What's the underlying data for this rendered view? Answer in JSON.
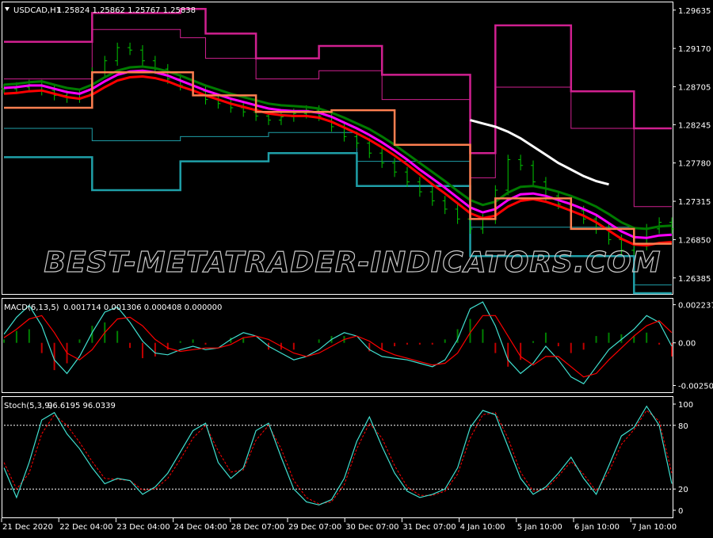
{
  "window": {
    "title": "USDCAD,H1",
    "ohlc": "1.25824 1.25862 1.25767 1.25838",
    "menu_icon": "triangle-down-icon"
  },
  "watermark": "BEST-METATRADER-INDICATORS.COM",
  "theme": {
    "background": "#000000",
    "grid": "#ffffff",
    "text": "#ffffff",
    "candles": "#00c800",
    "ma_green": "#007a00",
    "ma_magenta": "#ff00ff",
    "ma_red": "#ff0000",
    "step_orange": "#ff7f50",
    "band_upper": "#d02090",
    "band_lower": "#1f9fa8",
    "trend_white": "#ffffff",
    "macd_line": "#40e0d0",
    "macd_signal": "#ff0000",
    "stoch_main": "#40e0d0",
    "stoch_signal": "#ff0000"
  },
  "time_axis": [
    "21 Dec 2020",
    "22 Dec 04:00",
    "23 Dec 04:00",
    "24 Dec 04:00",
    "28 Dec 07:00",
    "29 Dec 07:00",
    "30 Dec 07:00",
    "31 Dec 07:00",
    "4 Jan 10:00",
    "5 Jan 10:00",
    "6 Jan 10:00",
    "7 Jan 10:00"
  ],
  "chart_data": [
    {
      "type": "line",
      "title": "USDCAD,H1",
      "price_ticks": [
        "1.29635",
        "1.29170",
        "1.28705",
        "1.28245",
        "1.27780",
        "1.27315",
        "1.26850",
        "1.26385"
      ],
      "ylim": [
        1.262,
        1.297
      ],
      "close": [
        1.2868,
        1.287,
        1.2873,
        1.2866,
        1.286,
        1.2857,
        1.2862,
        1.2888,
        1.2902,
        1.2918,
        1.2915,
        1.2902,
        1.2892,
        1.288,
        1.2872,
        1.2865,
        1.2855,
        1.285,
        1.2845,
        1.284,
        1.2835,
        1.283,
        1.2834,
        1.2838,
        1.2842,
        1.2835,
        1.2822,
        1.281,
        1.2802,
        1.279,
        1.2778,
        1.2767,
        1.2755,
        1.2743,
        1.2732,
        1.2722,
        1.271,
        1.2698,
        1.271,
        1.2745,
        1.2782,
        1.2775,
        1.2755,
        1.2738,
        1.2728,
        1.272,
        1.271,
        1.2698,
        1.2685,
        1.2672,
        1.2678,
        1.2698,
        1.2706,
        1.2698
      ],
      "ma_green": [
        1.2873,
        1.2874,
        1.2876,
        1.2877,
        1.2873,
        1.2869,
        1.2867,
        1.2873,
        1.2882,
        1.289,
        1.2894,
        1.2895,
        1.2893,
        1.2889,
        1.2884,
        1.2878,
        1.2872,
        1.2867,
        1.2862,
        1.2858,
        1.2854,
        1.285,
        1.2848,
        1.2847,
        1.2846,
        1.2844,
        1.2839,
        1.2833,
        1.2826,
        1.2819,
        1.281,
        1.28,
        1.2789,
        1.2778,
        1.2767,
        1.2756,
        1.2744,
        1.2733,
        1.2727,
        1.2731,
        1.2742,
        1.2749,
        1.275,
        1.2747,
        1.2743,
        1.2738,
        1.2732,
        1.2725,
        1.2716,
        1.2706,
        1.2699,
        1.2698,
        1.2701,
        1.2702
      ],
      "ma_magenta": [
        1.2869,
        1.287,
        1.2872,
        1.2872,
        1.2868,
        1.2864,
        1.2862,
        1.2868,
        1.2877,
        1.2885,
        1.2889,
        1.289,
        1.2888,
        1.2884,
        1.2878,
        1.2872,
        1.2866,
        1.2861,
        1.2856,
        1.2852,
        1.2848,
        1.2844,
        1.2842,
        1.2841,
        1.2841,
        1.2839,
        1.2834,
        1.2827,
        1.282,
        1.2812,
        1.2803,
        1.2793,
        1.2782,
        1.277,
        1.2759,
        1.2748,
        1.2736,
        1.2724,
        1.2718,
        1.2722,
        1.2733,
        1.274,
        1.2741,
        1.2738,
        1.2733,
        1.2728,
        1.2722,
        1.2715,
        1.2705,
        1.2695,
        1.2688,
        1.2687,
        1.269,
        1.2691
      ],
      "ma_red": [
        1.2862,
        1.2863,
        1.2865,
        1.2866,
        1.2862,
        1.2858,
        1.2856,
        1.2861,
        1.287,
        1.2878,
        1.2882,
        1.2883,
        1.2881,
        1.2877,
        1.2871,
        1.2866,
        1.286,
        1.2855,
        1.285,
        1.2846,
        1.2842,
        1.2838,
        1.2836,
        1.2835,
        1.2835,
        1.2833,
        1.2828,
        1.2821,
        1.2814,
        1.2806,
        1.2797,
        1.2787,
        1.2776,
        1.2764,
        1.2752,
        1.2741,
        1.2729,
        1.2717,
        1.2711,
        1.2714,
        1.2725,
        1.2732,
        1.2734,
        1.2731,
        1.2726,
        1.272,
        1.2714,
        1.2706,
        1.2696,
        1.2686,
        1.2679,
        1.2678,
        1.2681,
        1.2682
      ],
      "step_mid": [
        1.2845,
        1.2845,
        1.2845,
        1.2845,
        1.2845,
        1.2845,
        1.2845,
        1.2888,
        1.2888,
        1.2888,
        1.2888,
        1.2888,
        1.2888,
        1.2888,
        1.2888,
        1.286,
        1.286,
        1.286,
        1.286,
        1.286,
        1.284,
        1.284,
        1.284,
        1.284,
        1.284,
        1.284,
        1.2842,
        1.2842,
        1.2842,
        1.2842,
        1.2842,
        1.28,
        1.28,
        1.28,
        1.28,
        1.28,
        1.28,
        1.271,
        1.271,
        1.2735,
        1.2735,
        1.2735,
        1.2735,
        1.2735,
        1.2735,
        1.2698,
        1.2698,
        1.2698,
        1.2698,
        1.2698,
        1.268,
        1.268,
        1.268,
        1.268
      ],
      "upper_band": [
        1.2925,
        1.2925,
        1.2925,
        1.2925,
        1.2925,
        1.2925,
        1.2925,
        1.296,
        1.296,
        1.296,
        1.296,
        1.296,
        1.296,
        1.296,
        1.2965,
        1.2965,
        1.2935,
        1.2935,
        1.2935,
        1.2935,
        1.2905,
        1.2905,
        1.2905,
        1.2905,
        1.2905,
        1.292,
        1.292,
        1.292,
        1.292,
        1.292,
        1.2885,
        1.2885,
        1.2885,
        1.2885,
        1.2885,
        1.2885,
        1.2885,
        1.279,
        1.279,
        1.2945,
        1.2945,
        1.2945,
        1.2945,
        1.2945,
        1.2945,
        1.2865,
        1.2865,
        1.2865,
        1.2865,
        1.2865,
        1.282,
        1.282,
        1.282,
        1.282
      ],
      "upper_inner": [
        1.288,
        1.288,
        1.288,
        1.288,
        1.288,
        1.288,
        1.288,
        1.294,
        1.294,
        1.294,
        1.294,
        1.294,
        1.294,
        1.294,
        1.293,
        1.293,
        1.2905,
        1.2905,
        1.2905,
        1.2905,
        1.288,
        1.288,
        1.288,
        1.288,
        1.288,
        1.289,
        1.289,
        1.289,
        1.289,
        1.289,
        1.2855,
        1.2855,
        1.2855,
        1.2855,
        1.2855,
        1.2855,
        1.2855,
        1.276,
        1.276,
        1.287,
        1.287,
        1.287,
        1.287,
        1.287,
        1.287,
        1.282,
        1.282,
        1.282,
        1.282,
        1.282,
        1.2725,
        1.2725,
        1.2725,
        1.2725
      ],
      "lower_band": [
        1.2785,
        1.2785,
        1.2785,
        1.2785,
        1.2785,
        1.2785,
        1.2785,
        1.2745,
        1.2745,
        1.2745,
        1.2745,
        1.2745,
        1.2745,
        1.2745,
        1.278,
        1.278,
        1.278,
        1.278,
        1.278,
        1.278,
        1.278,
        1.279,
        1.279,
        1.279,
        1.279,
        1.279,
        1.279,
        1.279,
        1.275,
        1.275,
        1.275,
        1.275,
        1.275,
        1.275,
        1.275,
        1.275,
        1.275,
        1.2665,
        1.2665,
        1.2665,
        1.2665,
        1.2665,
        1.2665,
        1.2665,
        1.2665,
        1.2665,
        1.2665,
        1.2665,
        1.2665,
        1.2665,
        1.262,
        1.262,
        1.262,
        1.262
      ],
      "lower_inner": [
        1.282,
        1.282,
        1.282,
        1.282,
        1.282,
        1.282,
        1.282,
        1.2805,
        1.2805,
        1.2805,
        1.2805,
        1.2805,
        1.2805,
        1.2805,
        1.281,
        1.281,
        1.281,
        1.281,
        1.281,
        1.281,
        1.281,
        1.2815,
        1.2815,
        1.2815,
        1.2815,
        1.2815,
        1.2815,
        1.2815,
        1.278,
        1.278,
        1.278,
        1.278,
        1.278,
        1.278,
        1.278,
        1.278,
        1.278,
        1.27,
        1.27,
        1.27,
        1.27,
        1.27,
        1.27,
        1.27,
        1.27,
        1.27,
        1.27,
        1.27,
        1.27,
        1.27,
        1.263,
        1.263,
        1.263,
        1.263
      ],
      "trend_line": {
        "start_index": 37,
        "values": [
          1.283,
          1.2826,
          1.2822,
          1.2816,
          1.2808,
          1.2798,
          1.2788,
          1.2778,
          1.277,
          1.2762,
          1.2756,
          1.2752
        ]
      }
    },
    {
      "type": "line",
      "title": "MACD(6,13,5)",
      "values_label": "0.001714 0.001306 0.000408 0.000000",
      "ticks": [
        "0.002237",
        "0.00",
        "-0.002501"
      ],
      "ylim": [
        -0.00285,
        0.00245
      ],
      "macd": [
        0.0005,
        0.0015,
        0.0022,
        0.001,
        -0.001,
        -0.0018,
        -0.0008,
        0.0006,
        0.0018,
        0.0021,
        0.0012,
        0.0001,
        -0.0006,
        -0.0007,
        -0.0004,
        -0.0002,
        -0.0004,
        -0.0003,
        0.0002,
        0.0006,
        0.0004,
        -0.0002,
        -0.0006,
        -0.001,
        -0.0008,
        -0.0004,
        0.0002,
        0.0006,
        0.0004,
        -0.0004,
        -0.0008,
        -0.0009,
        -0.001,
        -0.0012,
        -0.0014,
        -0.001,
        0.0002,
        0.002,
        0.0024,
        0.001,
        -0.001,
        -0.0018,
        -0.0012,
        -0.0002,
        -0.001,
        -0.002,
        -0.0024,
        -0.0014,
        -0.0004,
        0.0002,
        0.0008,
        0.0016,
        0.0012,
        -0.0002
      ],
      "signal": [
        0.0003,
        0.0008,
        0.0014,
        0.0016,
        0.0006,
        -0.0006,
        -0.001,
        -0.0004,
        0.0006,
        0.0014,
        0.0015,
        0.001,
        0.0002,
        -0.0003,
        -0.0005,
        -0.0004,
        -0.0003,
        -0.0003,
        -0.0001,
        0.0003,
        0.0004,
        0.0002,
        -0.0002,
        -0.0006,
        -0.0008,
        -0.0006,
        -0.0002,
        0.0002,
        0.0004,
        0.0001,
        -0.0004,
        -0.0007,
        -0.0009,
        -0.0011,
        -0.0013,
        -0.0012,
        -0.0006,
        0.0006,
        0.0016,
        0.0016,
        0.0004,
        -0.0008,
        -0.0013,
        -0.0008,
        -0.0008,
        -0.0014,
        -0.002,
        -0.0018,
        -0.001,
        -0.0003,
        0.0004,
        0.001,
        0.0013,
        0.0006
      ]
    },
    {
      "type": "line",
      "title": "Stoch(5,3,9)",
      "values_label": "96.6195 96.0339",
      "ticks": [
        "100",
        "80",
        "20",
        "0"
      ],
      "levels": [
        80,
        20
      ],
      "ylim": [
        0,
        100
      ],
      "main": [
        40,
        12,
        45,
        85,
        92,
        72,
        58,
        40,
        25,
        30,
        28,
        15,
        22,
        35,
        55,
        75,
        82,
        45,
        30,
        40,
        75,
        82,
        50,
        20,
        8,
        5,
        10,
        30,
        65,
        88,
        60,
        35,
        18,
        12,
        15,
        20,
        40,
        78,
        94,
        90,
        60,
        30,
        15,
        22,
        35,
        50,
        30,
        15,
        42,
        70,
        78,
        98,
        80,
        25
      ],
      "signal": [
        45,
        20,
        35,
        72,
        90,
        80,
        64,
        46,
        30,
        29,
        28,
        19,
        20,
        30,
        48,
        68,
        80,
        56,
        36,
        38,
        66,
        80,
        58,
        28,
        12,
        6,
        8,
        24,
        58,
        82,
        68,
        42,
        22,
        14,
        14,
        18,
        34,
        68,
        90,
        92,
        68,
        36,
        18,
        20,
        32,
        46,
        34,
        18,
        36,
        62,
        76,
        94,
        84,
        35
      ]
    }
  ]
}
